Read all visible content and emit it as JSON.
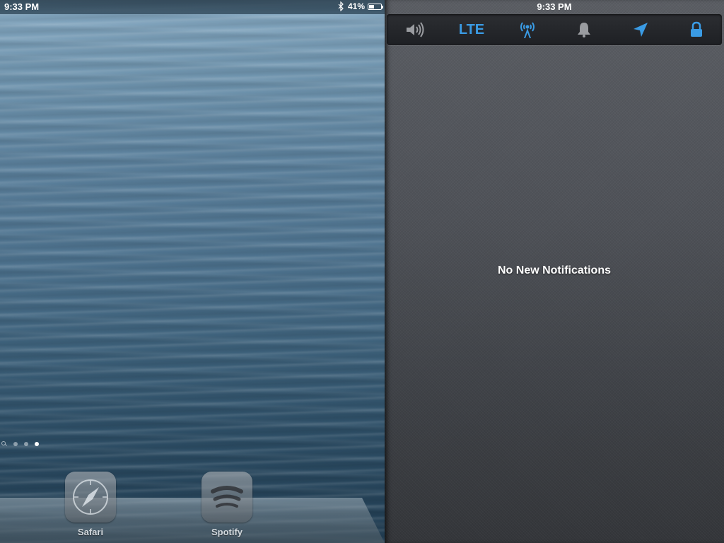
{
  "home": {
    "status_bar": {
      "time": "9:33 PM",
      "battery_percent": "41%",
      "battery_level": 0.41
    },
    "page_dots": {
      "count": 3,
      "active_index": 2
    },
    "dock": [
      {
        "label": "Safari",
        "icon": "safari-compass-icon"
      },
      {
        "label": "Spotify",
        "icon": "spotify-icon"
      }
    ]
  },
  "notification_center": {
    "time": "9:33 PM",
    "toggles": [
      {
        "name": "volume",
        "icon": "speaker-icon",
        "state": "off",
        "color": "#9a9ca0"
      },
      {
        "name": "lte",
        "label": "LTE",
        "state": "on",
        "color": "#3a9be4"
      },
      {
        "name": "hotspot",
        "icon": "antenna-icon",
        "state": "on",
        "color": "#3a9be4"
      },
      {
        "name": "notifications",
        "icon": "bell-icon",
        "state": "off",
        "color": "#9a9ca0"
      },
      {
        "name": "location",
        "icon": "location-arrow-icon",
        "state": "on",
        "color": "#3a9be4"
      },
      {
        "name": "rotation-lock",
        "icon": "lock-icon",
        "state": "on",
        "color": "#3a9be4"
      }
    ],
    "empty_message": "No New Notifications"
  }
}
